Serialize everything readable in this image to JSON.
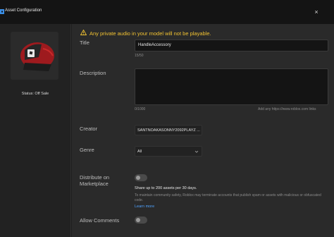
{
  "window": {
    "title": "Asset Configuration",
    "close_label": "×"
  },
  "sidebar": {
    "status": "Status: Off Sale"
  },
  "warning": {
    "text": "Any private audio in your model will not be playable."
  },
  "form": {
    "title_label": "Title",
    "title_value": "HandleAccessory",
    "title_count": "15/50",
    "description_label": "Description",
    "description_value": "",
    "description_count": "0/1000",
    "description_hint": "Add any https://www.roblox.com links",
    "creator_label": "Creator",
    "creator_value": "SANTNOAKASONNY2092PLAYZ ...",
    "genre_label": "Genre",
    "genre_value": "All",
    "distribute_label": "Distribute on Marketplace",
    "distribute_enabled": false,
    "share_text": "Share up to 200 assets per 30 days.",
    "policy_text": "To maintain community safety, Roblox may terminate accounts that publish spam or assets with malicious or obfuscated code.",
    "learn_more": "Learn more",
    "comments_label": "Allow Comments",
    "comments_enabled": false
  },
  "colors": {
    "warning": "#f1c232",
    "link": "#4fa3ff",
    "background": "#2a2a2a"
  },
  "icons": {
    "app": "roblox-studio-icon",
    "warning": "warning-triangle-icon",
    "close": "close-icon",
    "chevron": "chevron-down-icon"
  }
}
